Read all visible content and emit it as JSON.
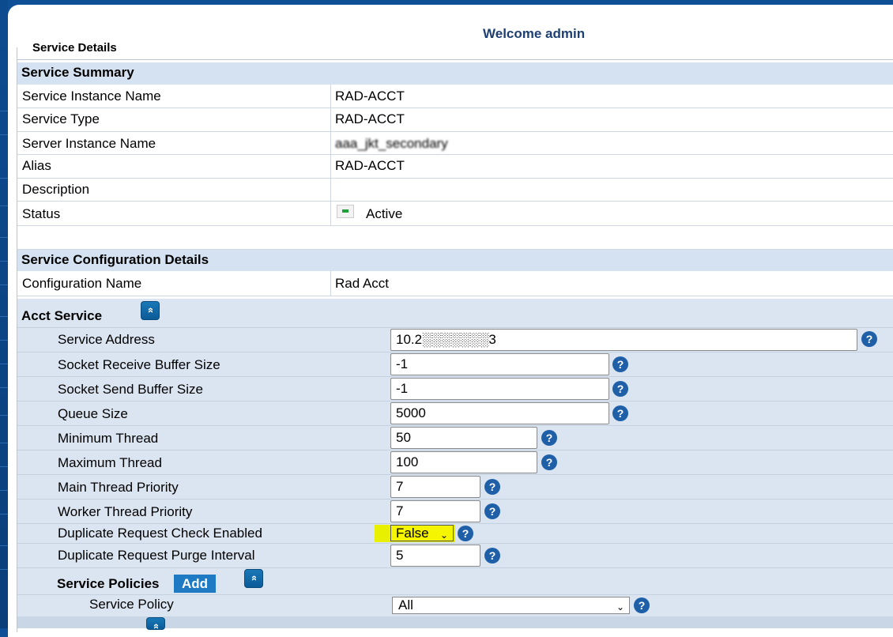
{
  "header": {
    "welcome": "Welcome admin",
    "page_title": "Service Details"
  },
  "summary": {
    "title": "Service Summary",
    "rows": [
      {
        "label": "Service Instance Name",
        "value": "RAD-ACCT"
      },
      {
        "label": "Service Type",
        "value": "RAD-ACCT"
      },
      {
        "label": "Server Instance Name",
        "value": "aaa_jkt_secondary"
      },
      {
        "label": "Alias",
        "value": "RAD-ACCT"
      },
      {
        "label": "Description",
        "value": ""
      },
      {
        "label": "Status",
        "value": "Active"
      }
    ]
  },
  "config": {
    "title": "Service Configuration Details",
    "name_label": "Configuration Name",
    "name_value": "Rad Acct"
  },
  "acct": {
    "title": "Acct Service",
    "fields": [
      {
        "label": "Service Address",
        "value": "10.2░░░░░░░3"
      },
      {
        "label": "Socket Receive Buffer Size",
        "value": "-1"
      },
      {
        "label": "Socket Send Buffer Size",
        "value": "-1"
      },
      {
        "label": "Queue Size",
        "value": "5000"
      },
      {
        "label": "Minimum Thread",
        "value": "50"
      },
      {
        "label": "Maximum Thread",
        "value": "100"
      },
      {
        "label": "Main Thread Priority",
        "value": "7"
      },
      {
        "label": "Worker Thread Priority",
        "value": "7"
      },
      {
        "label": "Duplicate Request Check Enabled",
        "value": "False"
      },
      {
        "label": "Duplicate Request Purge Interval",
        "value": "5"
      }
    ],
    "help_symbol": "?",
    "collapse_symbol": "»"
  },
  "policies": {
    "title": "Service Policies",
    "add_label": "Add",
    "policy_label": "Service Policy",
    "policy_value": "All"
  },
  "colors": {
    "section_bg": "#d5e2f1",
    "panel_bg": "#dbe5f1",
    "highlight": "#e8f000",
    "accent": "#1e7ac2"
  },
  "icons": [
    "status-active-icon",
    "help-icon",
    "collapse-up-icon",
    "chevron-down-icon"
  ]
}
